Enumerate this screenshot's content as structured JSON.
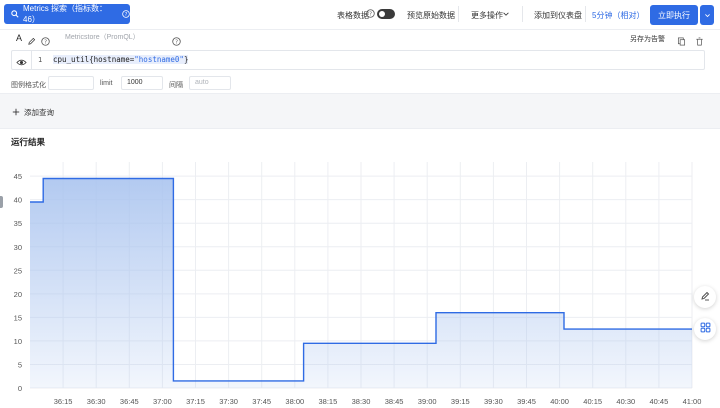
{
  "topbar": {
    "metrics_button": "Metrics 探索（指标数：46）",
    "table_data": "表格数据",
    "preview_raw": "预览原始数据",
    "more_actions": "更多操作",
    "add_dashboard": "添加到仪表盘",
    "time_range": "5分钟（相对）",
    "run_now": "立即执行"
  },
  "query_panel": {
    "label_icon_text": "A",
    "mode_placeholder": "Metricstore（PromQL）",
    "save_alert": "另存为告警",
    "line_number": "1",
    "code": {
      "prefix": "cpu_util{",
      "key": "hostname",
      "eq": "=",
      "value": "\"hostname0\"",
      "suffix": "}"
    },
    "legend_format_label": "图例格式化",
    "limit_label": "limit",
    "limit_value": "1000",
    "interval_label": "间隔",
    "interval_placeholder": "auto"
  },
  "add_query": "添加查询",
  "result": {
    "title": "运行结果"
  },
  "chart_data": {
    "type": "area",
    "title": "",
    "xlabel": "",
    "ylabel": "",
    "y_ticks": [
      0,
      5,
      10,
      15,
      20,
      25,
      30,
      35,
      40,
      45
    ],
    "ylim": [
      0,
      48
    ],
    "x_tick_labels": [
      "36:15",
      "36:30",
      "36:45",
      "37:00",
      "37:15",
      "37:30",
      "37:45",
      "38:00",
      "38:15",
      "38:30",
      "38:45",
      "39:00",
      "39:15",
      "39:30",
      "39:45",
      "40:00",
      "40:15",
      "40:30",
      "40:45",
      "41:00"
    ],
    "x_start": "36:00",
    "x_step_seconds": 15,
    "grid": true,
    "line_color": "#2f6be4",
    "fill_color": "#aac4ef",
    "series": [
      {
        "x_seconds": [
          0,
          6,
          6,
          65,
          65,
          124,
          124,
          184,
          184,
          242,
          242,
          300
        ],
        "values": [
          39.5,
          39.5,
          44.5,
          44.5,
          1.5,
          1.5,
          9.5,
          9.5,
          16,
          16,
          12.5,
          12.5
        ]
      }
    ]
  }
}
